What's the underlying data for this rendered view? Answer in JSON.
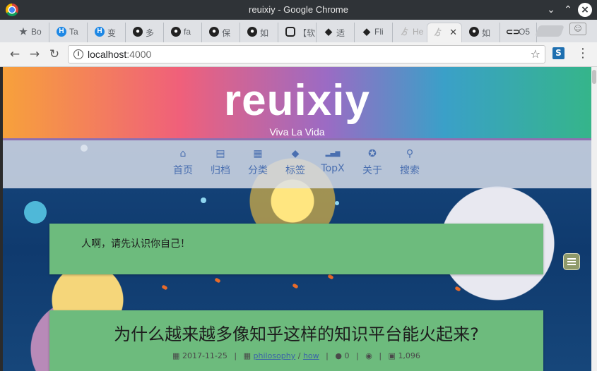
{
  "window": {
    "title": "reuixiy - Google Chrome"
  },
  "tabs": [
    {
      "label": "Bo",
      "icon": "star-icon",
      "color": "#5f6368"
    },
    {
      "label": "Ta",
      "icon": "h-icon",
      "color": "#1e88e5"
    },
    {
      "label": "变",
      "icon": "h-icon",
      "color": "#1e88e5"
    },
    {
      "label": "多",
      "icon": "github-icon",
      "color": "#222222"
    },
    {
      "label": "fa",
      "icon": "github-icon",
      "color": "#222222"
    },
    {
      "label": "保",
      "icon": "github-icon",
      "color": "#222222"
    },
    {
      "label": "如",
      "icon": "github-icon",
      "color": "#222222"
    },
    {
      "label": "【软",
      "icon": "square-icon",
      "color": "#222222"
    },
    {
      "label": "适",
      "icon": "diamond-icon",
      "color": "#222222"
    },
    {
      "label": "Fli",
      "icon": "diamond-icon",
      "color": "#222222"
    },
    {
      "label": "He",
      "icon": "logo-icon",
      "color": "#bbbbbb"
    },
    {
      "label": "",
      "icon": "logo-icon",
      "color": "#bbbbbb"
    },
    {
      "label": "如",
      "icon": "github-icon",
      "color": "#222222"
    },
    {
      "label": "O5",
      "icon": "link-icon",
      "color": "#222222"
    }
  ],
  "toolbar": {
    "url_host": "localhost",
    "url_port": ":4000"
  },
  "site": {
    "title": "reuixiy",
    "subtitle": "Viva La Vida"
  },
  "nav": [
    {
      "label": "首页",
      "icon": "home-icon",
      "glyph": "⌂"
    },
    {
      "label": "归档",
      "icon": "archive-icon",
      "glyph": "▤"
    },
    {
      "label": "分类",
      "icon": "grid-icon",
      "glyph": "▦"
    },
    {
      "label": "标签",
      "icon": "tag-icon",
      "glyph": "◆"
    },
    {
      "label": "TopX",
      "icon": "bar-chart-icon",
      "glyph": "▂▄▆"
    },
    {
      "label": "关于",
      "icon": "about-icon",
      "glyph": "✪"
    },
    {
      "label": "搜索",
      "icon": "search-icon",
      "glyph": "⚲"
    }
  ],
  "quote": "人啊，请先认识你自己！",
  "post": {
    "title": "为什么越来越多像知乎这样的知识平台能火起来?",
    "date": "2017-11-25",
    "category": "philosophy",
    "subcategory": "how",
    "comments": "0",
    "words": "1,096"
  },
  "colors": {
    "card": "#6dbb7d",
    "nav_text": "#4a6fb0"
  }
}
